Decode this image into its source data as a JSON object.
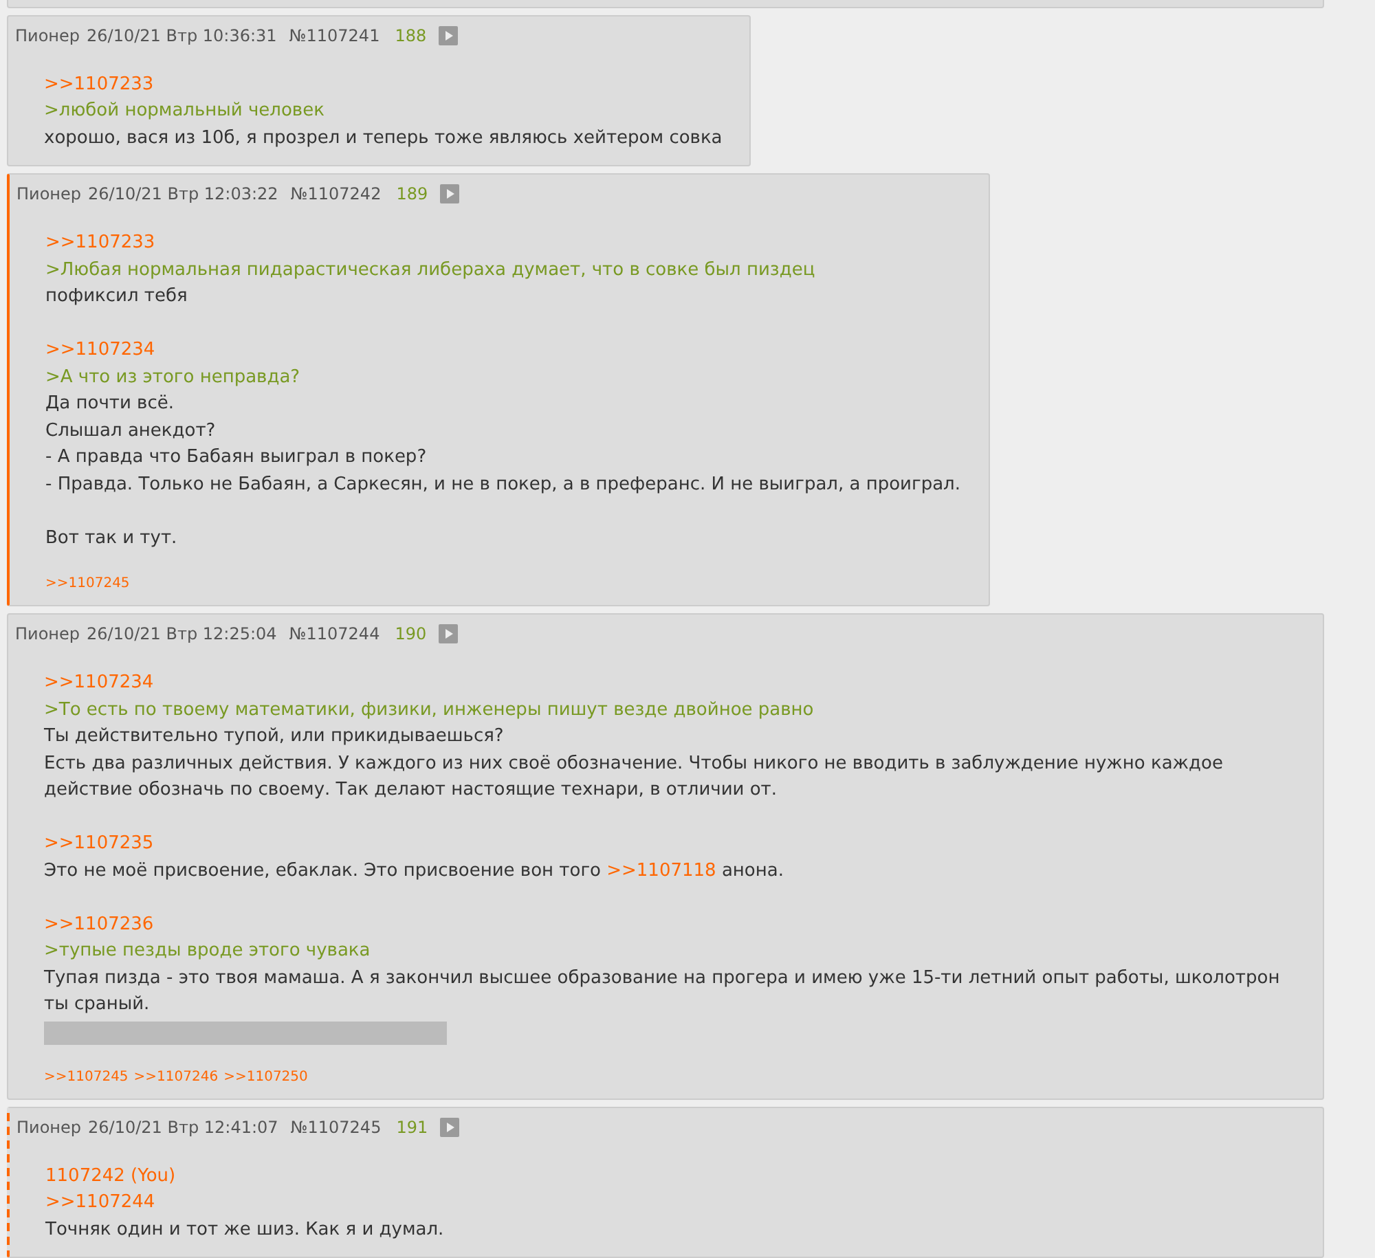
{
  "posts": [
    {
      "own": false,
      "replies_to_own": false,
      "name": "Пионер",
      "date": "26/10/21 Втр 10:36:31",
      "number": "№1107241",
      "count": "188",
      "lines": [
        {
          "kind": "reply",
          "text": ">>1107233"
        },
        {
          "kind": "quote",
          "text": ">любой нормальный человек"
        },
        {
          "kind": "text",
          "text": "хорошо, вася из 10б, я прозрел и теперь тоже являюсь хейтером совка"
        }
      ]
    },
    {
      "own": true,
      "replies_to_own": false,
      "name": "Пионер",
      "date": "26/10/21 Втр 12:03:22",
      "number": "№1107242",
      "count": "189",
      "lines": [
        {
          "kind": "reply",
          "text": ">>1107233"
        },
        {
          "kind": "quote",
          "text": ">Любая нормальная пидарастическая либераха думает, что в совке был пиздец"
        },
        {
          "kind": "text",
          "text": "пофиксил тебя"
        },
        {
          "kind": "gap"
        },
        {
          "kind": "reply",
          "text": ">>1107234"
        },
        {
          "kind": "quote",
          "text": ">А что из этого неправда?"
        },
        {
          "kind": "text",
          "text": "Да почти всё."
        },
        {
          "kind": "text",
          "text": "Слышал анекдот?"
        },
        {
          "kind": "text",
          "text": "- А правда что Бабаян выиграл в покер?"
        },
        {
          "kind": "text",
          "text": "- Правда. Только не Бабаян, а Саркесян, и не в покер, а в преферанс. И не выиграл, а проиграл."
        },
        {
          "kind": "gap"
        },
        {
          "kind": "text",
          "text": "Вот так и тут."
        }
      ],
      "replies": [
        ">>1107245"
      ]
    },
    {
      "own": false,
      "replies_to_own": false,
      "name": "Пионер",
      "date": "26/10/21 Втр 12:25:04",
      "number": "№1107244",
      "count": "190",
      "lines": [
        {
          "kind": "reply",
          "text": ">>1107234"
        },
        {
          "kind": "quote",
          "text": ">То есть по твоему математики, физики, инженеры пишут везде двойное равно"
        },
        {
          "kind": "text",
          "text": "Ты действительно тупой, или прикидываешься?"
        },
        {
          "kind": "text",
          "text": "Есть два различных действия. У каждого из них своё обозначение. Чтобы никого не вводить в заблуждение нужно каждое действие обозначь по своему. Так делают настоящие технари, в отличии от."
        },
        {
          "kind": "gap"
        },
        {
          "kind": "reply",
          "text": ">>1107235"
        },
        {
          "kind": "mixed",
          "parts": [
            {
              "kind": "plain",
              "text": "Это не моё присвоение, ебаклак. Это присвоение вон того "
            },
            {
              "kind": "link",
              "text": ">>1107118"
            },
            {
              "kind": "plain",
              "text": " анона."
            }
          ]
        },
        {
          "kind": "gap"
        },
        {
          "kind": "reply",
          "text": ">>1107236"
        },
        {
          "kind": "quote",
          "text": ">тупые пезды вроде этого чувака"
        },
        {
          "kind": "text",
          "text": "Тупая пизда - это твоя мамаша. А я закончил высшее образование на прогера и имею уже 15-ти летний опыт работы, школотрон ты сраный."
        },
        {
          "kind": "spoiler"
        }
      ],
      "replies": [
        ">>1107245",
        ">>1107246",
        ">>1107250"
      ]
    },
    {
      "own": false,
      "replies_to_own": true,
      "name": "Пионер",
      "date": "26/10/21 Втр 12:41:07",
      "number": "№1107245",
      "count": "191",
      "lines": [
        {
          "kind": "reply",
          "text": "1107242 (You)"
        },
        {
          "kind": "reply",
          "text": ">>1107244"
        },
        {
          "kind": "text",
          "text": "Точняк один и тот же шиз. Как я и думал."
        }
      ]
    }
  ]
}
